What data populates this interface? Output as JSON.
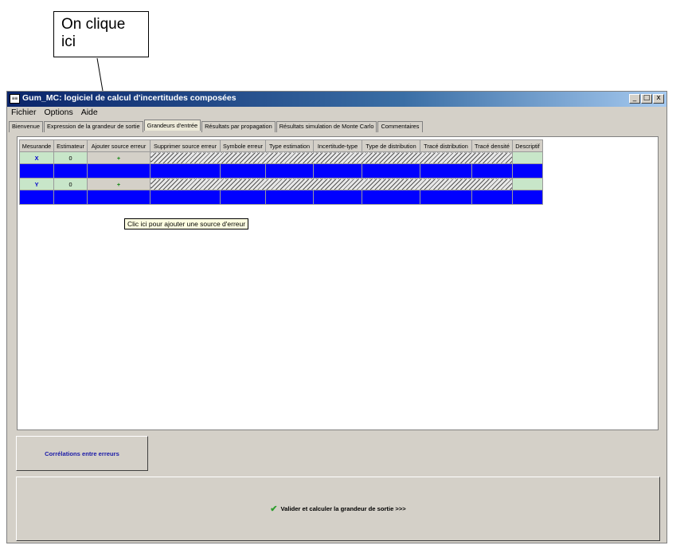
{
  "annotation": {
    "text": "On clique ici"
  },
  "window": {
    "title": "Gum_MC: logiciel de calcul d'incertitudes composées",
    "icon_text": "≡≡",
    "controls": [
      "_",
      "□",
      "x"
    ]
  },
  "menu": [
    "Fichier",
    "Options",
    "Aide"
  ],
  "tabs": [
    "Bienvenue",
    "Expression de la grandeur de sortie",
    "Grandeurs d'entrée",
    "Résultats par propagation",
    "Résultats simulation de Monte Carlo",
    "Commentaires"
  ],
  "active_tab_index": 2,
  "table": {
    "headers": [
      "Mesurande",
      "Estimateur",
      "Ajouter source erreur",
      "Supprimer source erreur",
      "Symbole erreur",
      "Type estimation",
      "Incertitude-type",
      "Type de distribution",
      "Tracé distribution",
      "Tracé densité",
      "Descriptif"
    ],
    "rows": [
      {
        "mesurande": "X",
        "estimateur": "0",
        "add": "+"
      },
      {
        "mesurande": "Y",
        "estimateur": "0",
        "add": "+"
      }
    ]
  },
  "tooltip": "Clic ici pour ajouter une source d'erreur",
  "buttons": {
    "correlations": "Corrélations entre erreurs",
    "validate": "Valider et calculer la grandeur de sortie >>>"
  },
  "colors": {
    "blue_row": "#0000ff",
    "green_cell": "#c8e6c9",
    "title_gradient_start": "#0a246a"
  }
}
